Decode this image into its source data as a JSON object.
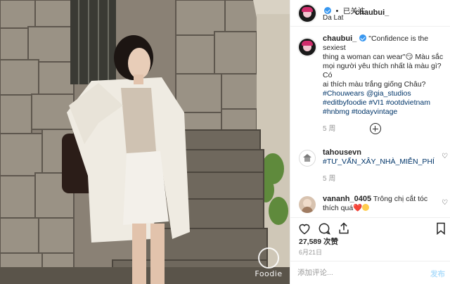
{
  "header": {
    "username": "chaubui_",
    "separator": "•",
    "follow_status": "已关注",
    "location": "Da Lat"
  },
  "caption": {
    "username": "chaubui_",
    "lines": [
      "\"Confidence is the sexiest",
      "thing a woman can wear\"😏 Màu sắc",
      "mọi người yêu thích nhất là màu gì? Có",
      "ai thích màu trắng giống Châu?"
    ],
    "tags": [
      "#Chouwears @gia_studios",
      "#editbyfoodie #VI1 #ootdvietnam",
      "#hnbmg #todayvintage"
    ],
    "time": "5 周"
  },
  "comments": [
    {
      "username": "tahousevn",
      "text": "#TƯ_VẤN_XÂY_NHÀ_MIỄN_PHÍ",
      "time": "5 周"
    },
    {
      "username": "vananh_0405",
      "text_line1": "Trông chị cắt tóc",
      "text_line2": "thích quá",
      "heart": "❤️"
    }
  ],
  "stats": {
    "likes": "27,589 次赞",
    "date": "6月21日"
  },
  "composer": {
    "placeholder": "添加评论...",
    "post_label": "发布"
  },
  "watermark": {
    "text": "Foodie"
  },
  "colors": {
    "link": "#003569",
    "verified": "#3897f0",
    "muted": "#999999",
    "post_disabled": "#b2dffc"
  }
}
